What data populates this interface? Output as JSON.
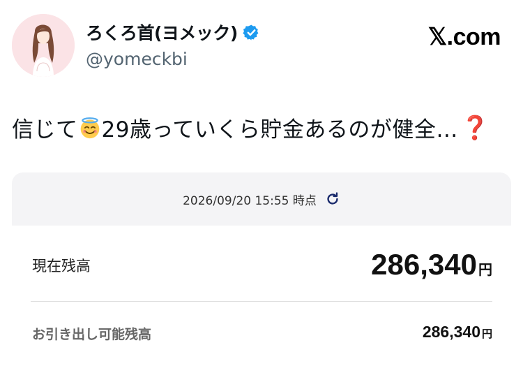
{
  "profile": {
    "display_name": "ろくろ首(ヨメック)",
    "handle": "@yomeckbi",
    "verified_icon": "verified-badge-icon",
    "avatar_icon": "avatar-illustration"
  },
  "site": "𝕏.com",
  "tweet": {
    "before_emoji": "信じて",
    "face_emoji_icon": "smiling-face-with-halo-icon",
    "after_emoji": "29歳っていくら貯金あるのが健全…",
    "end_emoji": "❓"
  },
  "balance_card": {
    "timestamp": "2026/09/20 15:55 時点",
    "refresh_icon": "refresh-icon",
    "current_label": "現在残高",
    "current_amount": "286,340",
    "current_unit": "円",
    "withdrawable_label": "お引き出し可能残高",
    "withdrawable_amount": "286,340",
    "withdrawable_unit": "円"
  },
  "colors": {
    "verified": "#1d9bf0",
    "handle": "#536471",
    "card_header_bg": "#f4f4f6",
    "refresh": "#1a2a6c",
    "question": "#dd2e44"
  }
}
